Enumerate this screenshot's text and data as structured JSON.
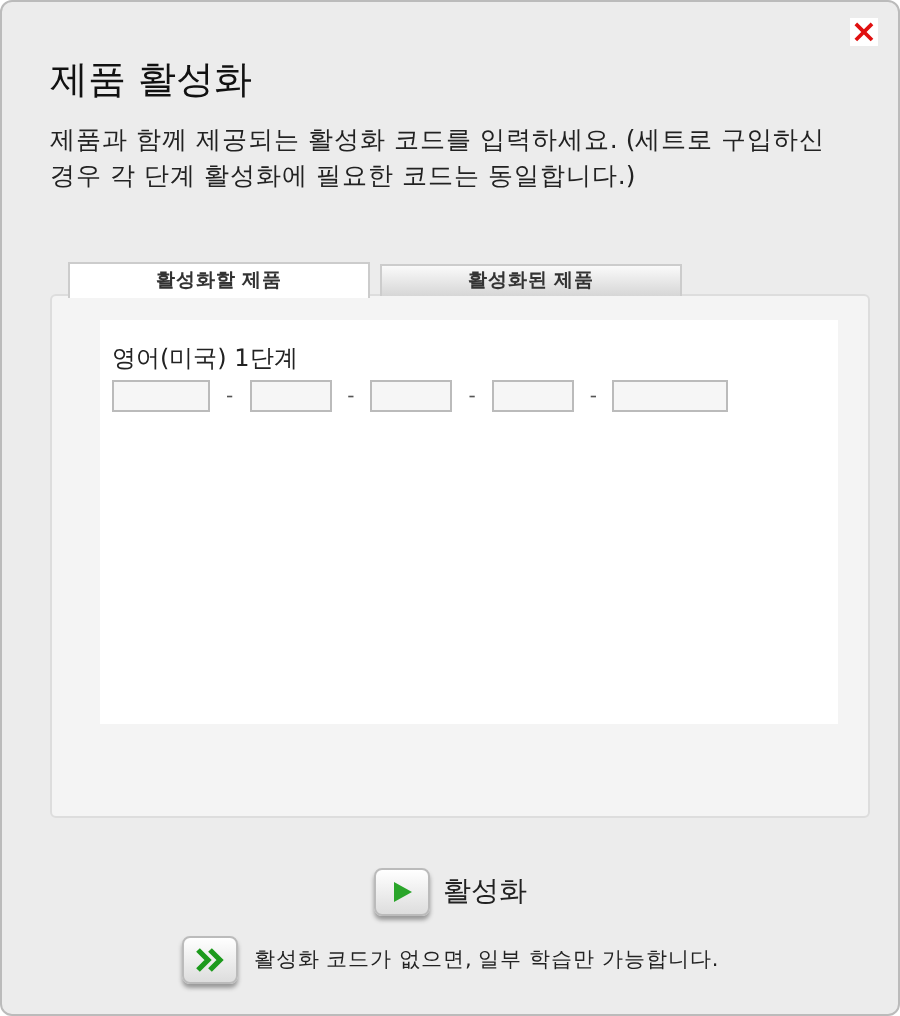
{
  "window": {
    "title": "제품 활성화",
    "close": "×"
  },
  "description": "제품과 함께 제공되는 활성화 코드를 입력하세요. (세트로 구입하신 경우 각 단계 활성화에 필요한 코드는 동일합니다.)",
  "tabs": [
    {
      "label": "활성화할 제품",
      "selected": true
    },
    {
      "label": "활성화된 제품",
      "selected": false
    }
  ],
  "product": {
    "label": "영어(미국) 1단계",
    "code_fields": [
      {
        "kind": "wide"
      },
      {
        "kind": "narrow",
        "separator": "-"
      },
      {
        "kind": "narrow",
        "separator": "-"
      },
      {
        "kind": "narrow",
        "separator": "-"
      },
      {
        "kind": "wide",
        "separator": "-"
      }
    ]
  },
  "activate_button": {
    "label": "활성화"
  },
  "no_code_link": {
    "label": "활성화 코드가 없으면, 일부 학습만 가능합니다."
  }
}
